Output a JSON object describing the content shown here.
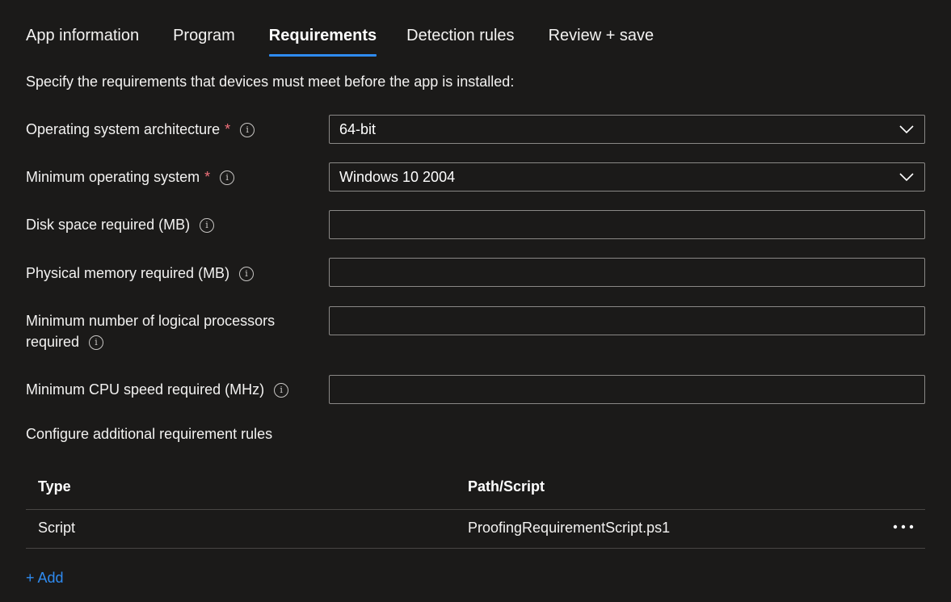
{
  "tabs": [
    {
      "label": "App information"
    },
    {
      "label": "Program"
    },
    {
      "label": "Requirements"
    },
    {
      "label": "Detection rules"
    },
    {
      "label": "Review + save"
    }
  ],
  "intro": "Specify the requirements that devices must meet before the app is installed:",
  "fields": {
    "os_arch": {
      "label": "Operating system architecture",
      "required": "*",
      "value": "64-bit"
    },
    "min_os": {
      "label": "Minimum operating system",
      "required": "*",
      "value": "Windows 10 2004"
    },
    "disk": {
      "label": "Disk space required (MB)",
      "value": ""
    },
    "memory": {
      "label": "Physical memory required (MB)",
      "value": ""
    },
    "processors": {
      "label_line1": "Minimum number of logical processors",
      "label_line2": "required",
      "value": ""
    },
    "cpu": {
      "label": "Minimum CPU speed required (MHz)",
      "value": ""
    }
  },
  "additional": {
    "title": "Configure additional requirement rules",
    "columns": [
      "Type",
      "Path/Script"
    ],
    "rows": [
      {
        "type": "Script",
        "path": "ProofingRequirementScript.ps1"
      }
    ],
    "add_label": "+ Add"
  },
  "icons": {
    "info": "info-icon",
    "chevron": "chevron-down-icon",
    "more": "more-icon"
  },
  "colors": {
    "accent": "#2f8bf0",
    "required": "#f1707b",
    "background": "#1b1a19"
  }
}
